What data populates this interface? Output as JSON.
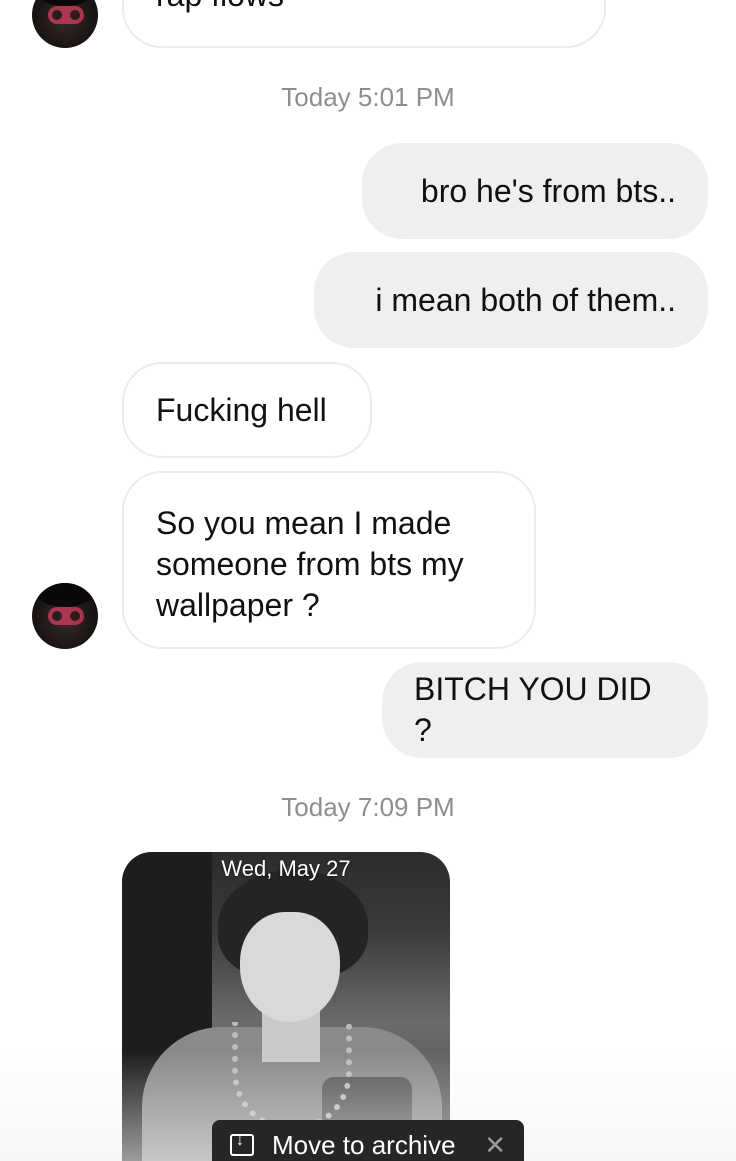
{
  "messages": {
    "m0": "rap flows",
    "ts1": "Today 5:01 PM",
    "m1": "bro he's from bts..",
    "m2": "i mean both of them..",
    "m3": "Fucking hell",
    "m4": "So you mean I made\nsomeone from bts my\nwallpaper ?",
    "m5": "BITCH YOU DID ?",
    "ts2": "Today 7:09 PM"
  },
  "photo": {
    "date_label": "Wed, May 27"
  },
  "toast": {
    "label": "Move to archive",
    "icon": "archive-icon",
    "close_icon": "close-icon"
  }
}
